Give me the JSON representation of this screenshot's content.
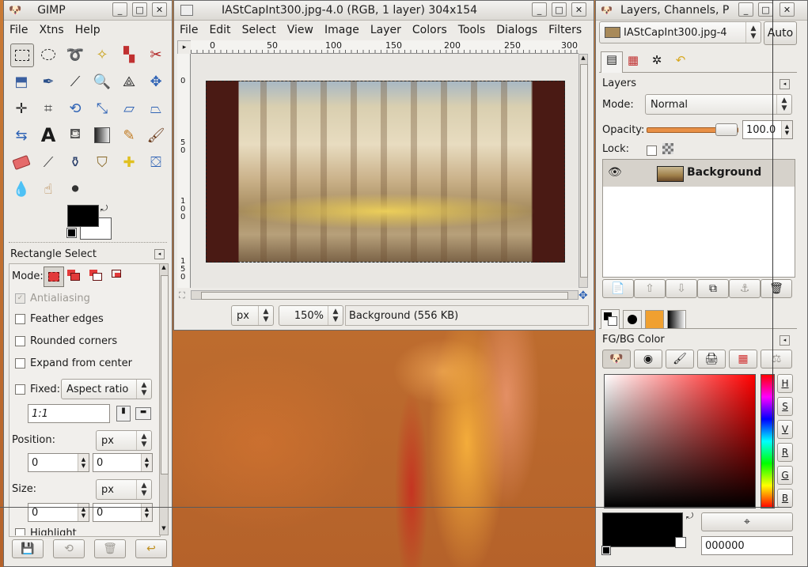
{
  "toolbox": {
    "title": "GIMP",
    "menu": [
      "File",
      "Xtns",
      "Help"
    ],
    "tool_options": {
      "title": "Rectangle Select",
      "mode_label": "Mode:",
      "antialiasing": "Antialiasing",
      "feather_edges": "Feather edges",
      "rounded_corners": "Rounded corners",
      "expand_from_center": "Expand from center",
      "fixed_label": "Fixed:",
      "fixed_value": "Aspect ratio",
      "ratio_value": "1:1",
      "position_label": "Position:",
      "position_unit": "px",
      "position_x": "0",
      "position_y": "0",
      "size_label": "Size:",
      "size_unit": "px",
      "size_w": "0",
      "size_h": "0",
      "highlight": "Highlight"
    }
  },
  "image_window": {
    "title": "IAStCapInt300.jpg-4.0 (RGB, 1 layer) 304x154",
    "menu": [
      "File",
      "Edit",
      "Select",
      "View",
      "Image",
      "Layer",
      "Colors",
      "Tools",
      "Dialogs",
      "Filters"
    ],
    "ruler_top": [
      "0",
      "50",
      "100",
      "150",
      "200",
      "250",
      "300"
    ],
    "ruler_left": [
      "0",
      "5\n0",
      "1\n0\n0",
      "1\n5\n0"
    ],
    "unit": "px",
    "zoom": "150%",
    "status": "Background (556 KB)"
  },
  "layers_dock": {
    "title": "Layers, Channels, P",
    "image_select": "IAStCapInt300.jpg-4",
    "auto_button": "Auto",
    "panel_title": "Layers",
    "mode_label": "Mode:",
    "mode_value": "Normal",
    "opacity_label": "Opacity:",
    "opacity_value": "100.0",
    "opacity_fraction": 1.0,
    "lock_label": "Lock:",
    "layers": [
      {
        "name": "Background"
      }
    ],
    "color_panel_title": "FG/BG Color",
    "side_buttons": [
      "H",
      "S",
      "V",
      "R",
      "G",
      "B"
    ],
    "hex_value": "000000"
  },
  "colors": {
    "fg": "#000000",
    "bg": "#ffffff",
    "desktop": "#c06a28",
    "accent_orange": "#f0a030"
  }
}
